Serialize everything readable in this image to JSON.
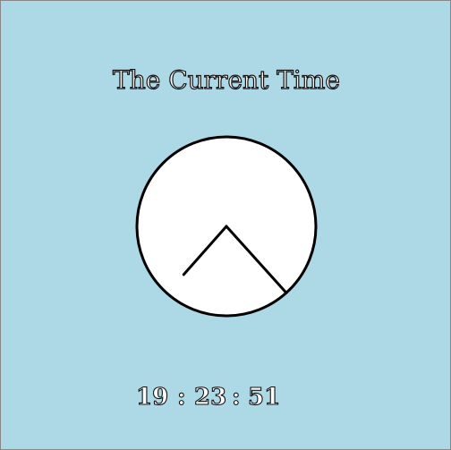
{
  "app": {
    "title": "The Current Time"
  },
  "clock": {
    "hour_hand": {
      "hours": 19,
      "minutes": 23
    },
    "minute_hand": {
      "minutes": 23
    }
  },
  "digital": {
    "hours": "19",
    "separator": ":",
    "minutes": "23",
    "seconds": "51"
  },
  "colors": {
    "background": "#add8e6",
    "window_border": "#888888",
    "clock_face": "#ffffff",
    "clock_outline": "#000000",
    "hands": "#000000"
  }
}
